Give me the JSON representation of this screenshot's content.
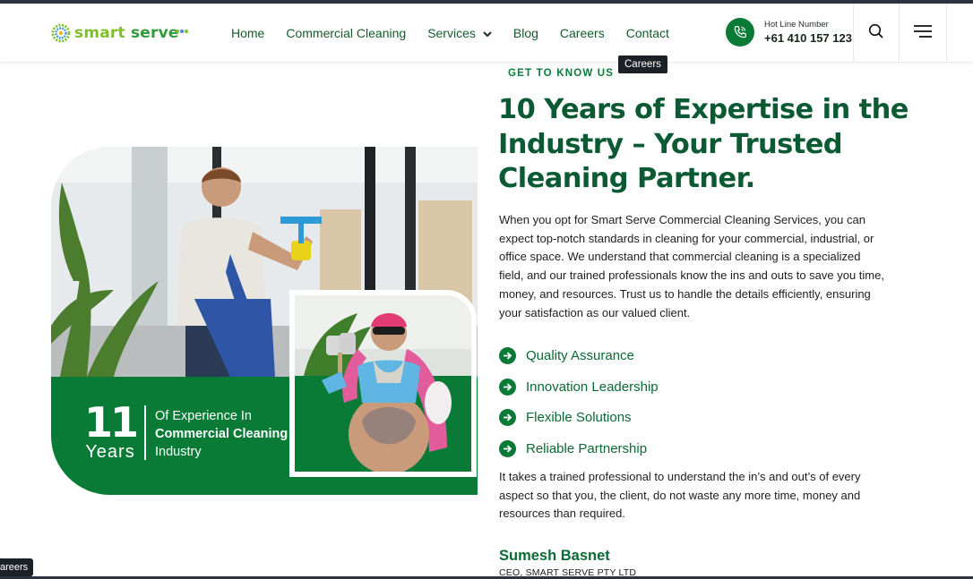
{
  "brand": {
    "logo_text_a": "smart",
    "logo_text_b": "serve"
  },
  "nav": {
    "items": [
      {
        "label": "Home"
      },
      {
        "label": "Commercial Cleaning"
      },
      {
        "label": "Services"
      },
      {
        "label": "Blog"
      },
      {
        "label": "Careers"
      },
      {
        "label": "Contact"
      }
    ],
    "tooltip": "Careers"
  },
  "hotline": {
    "label": "Hot Line Number",
    "number": "+61 410 157 123"
  },
  "hero": {
    "years_number": "11",
    "years_word": "Years",
    "exp_line1": "Of Experience In",
    "exp_line2": "Commercial Cleaning",
    "exp_line3": "Industry"
  },
  "content": {
    "kicker": "GET TO KNOW US",
    "title": "10 Years of Expertise in the Industry – Your Trusted Cleaning Partner.",
    "paragraph": "When you opt for Smart Serve Commercial Cleaning Services, you can expect top-notch standards in cleaning for your commercial, industrial, or office space. We understand that commercial cleaning is a specialized field, and our trained professionals know the ins and outs to save you time, money, and resources. Trust us to handle the details efficiently, ensuring your satisfaction as our valued client.",
    "features": [
      {
        "label": "Quality Assurance"
      },
      {
        "label": "Innovation Leadership"
      },
      {
        "label": "Flexible Solutions"
      },
      {
        "label": "Reliable Partnership"
      }
    ],
    "paragraph2": "It takes a trained professional to understand the in’s and out’s of every aspect so that you, the client, do not waste any more time, money and resources than required.",
    "author": "Sumesh Basnet",
    "role": "CEO, SMART SERVE PTY LTD"
  },
  "bottom_tooltip": "areers",
  "colors": {
    "primary": "#0a7a37",
    "heading": "#0b5a33",
    "accent_lime": "#7fbf2a"
  },
  "icons": [
    "phone-icon",
    "search-icon",
    "menu-icon",
    "chevron-down-icon",
    "arrow-right-circle-icon"
  ]
}
